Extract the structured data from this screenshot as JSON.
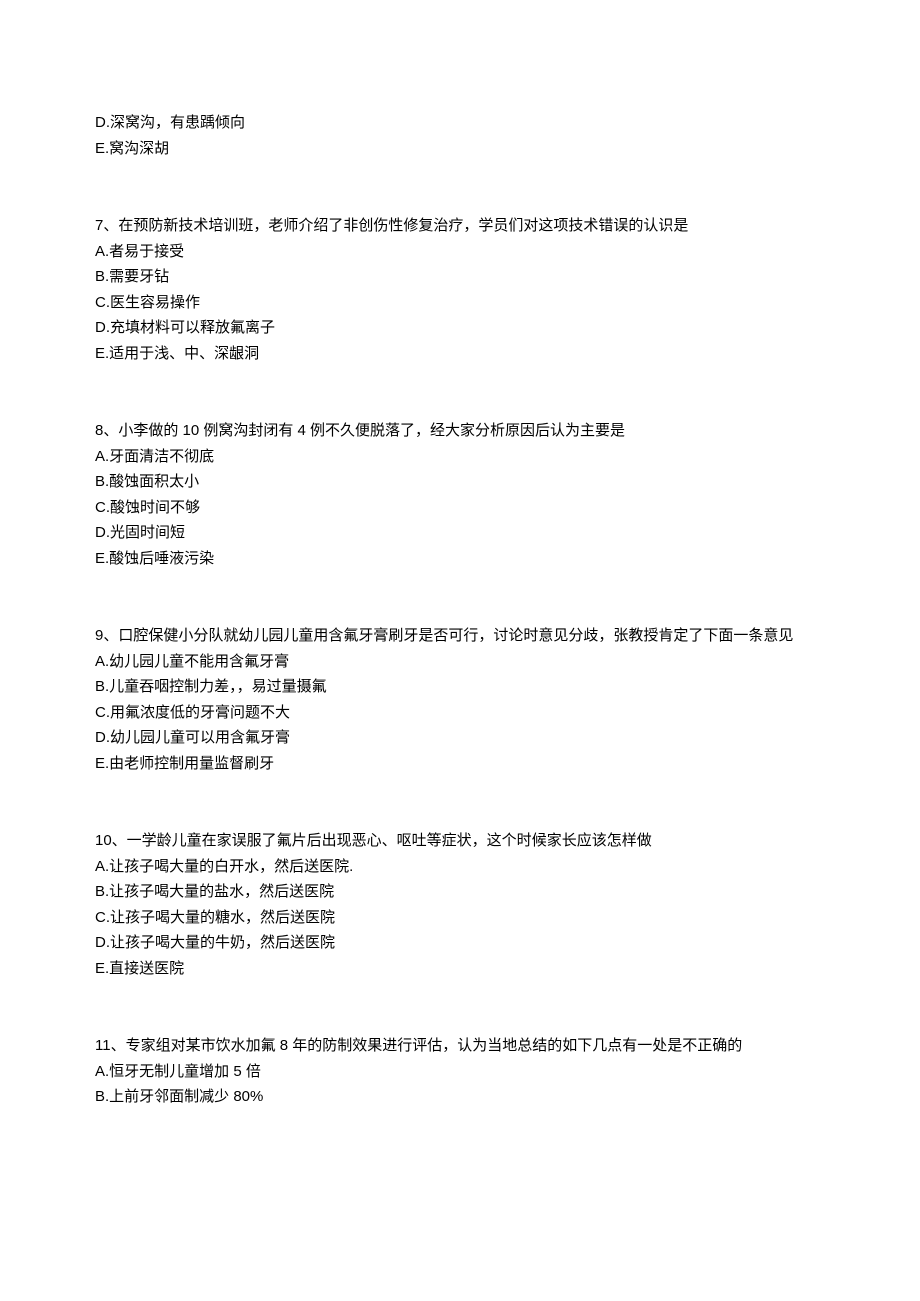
{
  "blocks": [
    {
      "lines": [
        "D.深窝沟，有患踽倾向",
        "E.窝沟深胡"
      ]
    },
    {
      "lines": [
        "7、在预防新技术培训班，老师介绍了非创伤性修复治疗，学员们对这项技术错误的认识是",
        "A.者易于接受",
        "B.需要牙钻",
        "C.医生容易操作",
        "D.充填材料可以释放氟离子",
        "E.适用于浅、中、深龈洞"
      ]
    },
    {
      "lines": [
        "8、小李做的 10 例窝沟封闭有 4 例不久便脱落了，经大家分析原因后认为主要是",
        "A.牙面清洁不彻底",
        "B.酸蚀面积太小",
        "C.酸蚀时间不够",
        "D.光固时间短",
        "E.酸蚀后唾液污染"
      ]
    },
    {
      "lines": [
        "9、口腔保健小分队就幼儿园儿童用含氟牙膏刷牙是否可行，讨论时意见分歧，张教授肯定了下面一条意见",
        "A.幼儿园儿童不能用含氟牙膏",
        "B.儿童吞咽控制力差，，易过量摄氟",
        "C.用氟浓度低的牙膏问题不大",
        "D.幼儿园儿童可以用含氟牙膏",
        "E.由老师控制用量监督刷牙"
      ]
    },
    {
      "lines": [
        "10、一学龄儿童在家误服了氟片后出现恶心、呕吐等症状，这个时候家长应该怎样做",
        "A.让孩子喝大量的白开水，然后送医院.",
        "B.让孩子喝大量的盐水，然后送医院",
        "C.让孩子喝大量的糖水，然后送医院",
        "D.让孩子喝大量的牛奶，然后送医院",
        "E.直接送医院"
      ]
    },
    {
      "lines": [
        "11、专家组对某市饮水加氟 8 年的防制效果进行评估，认为当地总结的如下几点有一处是不正确的",
        "A.恒牙无制儿童增加 5 倍",
        "B.上前牙邻面制减少 80%"
      ]
    }
  ]
}
